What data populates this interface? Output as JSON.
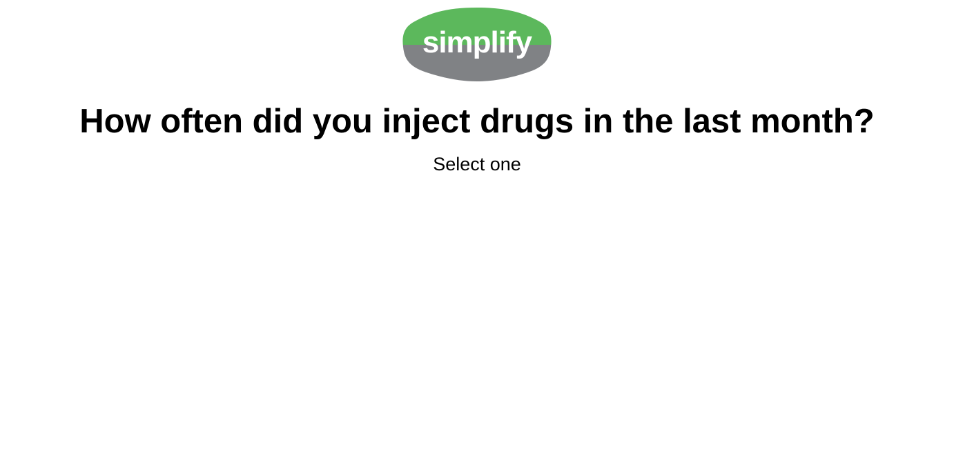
{
  "logo": {
    "text": "simplify",
    "colors": {
      "top": "#5cb85c",
      "bottom": "#808285",
      "text": "#ffffff"
    }
  },
  "question": {
    "title": "How often did you inject drugs in the last month?",
    "instruction": "Select one"
  }
}
